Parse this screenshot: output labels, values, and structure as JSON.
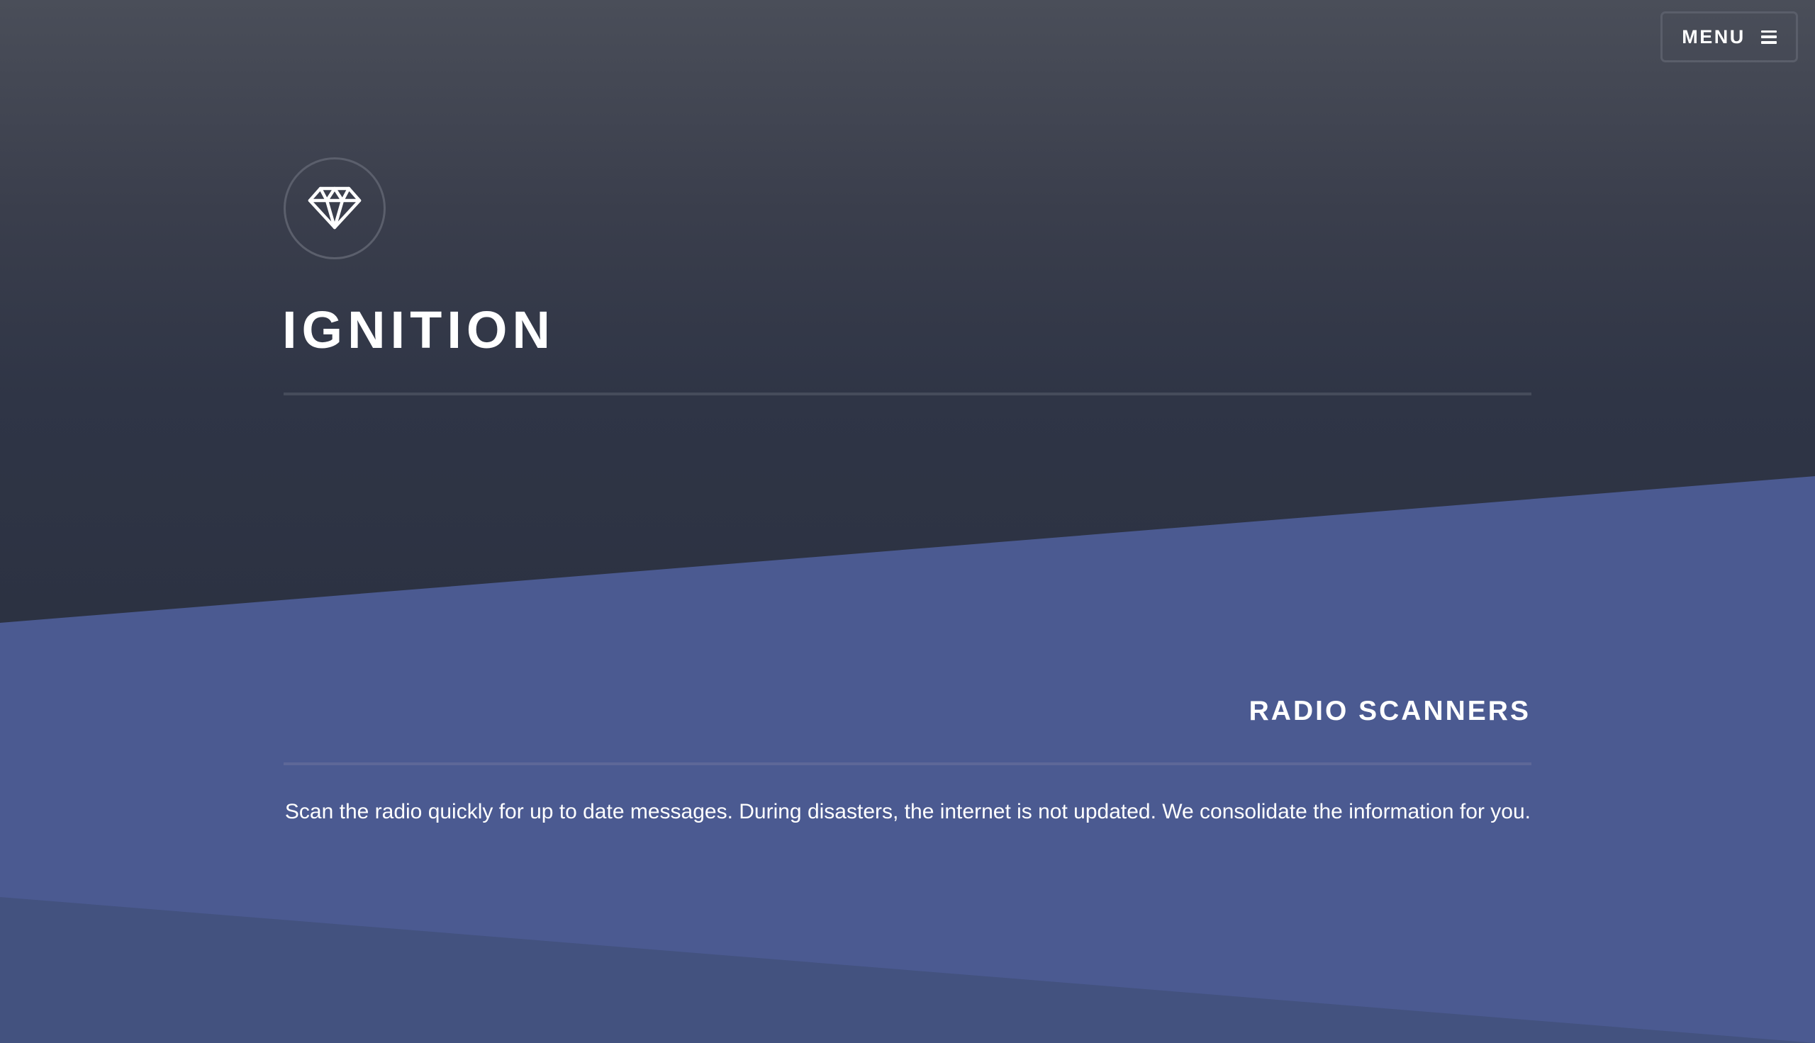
{
  "header": {
    "menu_label": "MENU",
    "menu_icon": "hamburger-icon"
  },
  "banner": {
    "logo_icon": "diamond-icon",
    "title": "IGNITION"
  },
  "section": {
    "heading": "RADIO SCANNERS",
    "text": "Scan the radio quickly for up to date messages. During disasters, the internet is not updated. We consolidate the information for you."
  },
  "colors": {
    "banner_top": "#4a4e59",
    "banner_bottom": "#2c3242",
    "section_bg": "#4b5a91",
    "lower_band": "#43527f",
    "text": "#ffffff"
  }
}
